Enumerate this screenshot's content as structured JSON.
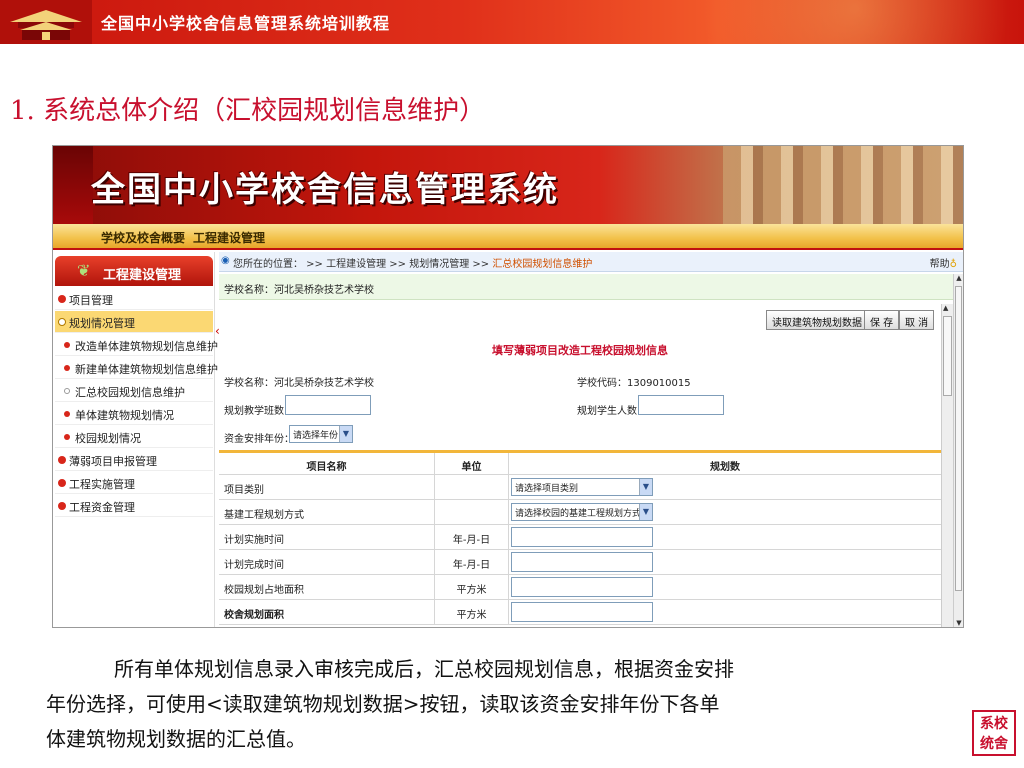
{
  "slide": {
    "header_title": "全国中小学校舍信息管理系统培训教程",
    "section_title": "1. 系统总体介绍（汇校园规划信息维护）",
    "paragraph_line1": "所有单体规划信息录入审核完成后，汇总校园规划信息，根据资金安排",
    "paragraph_line2": "年份选择，可使用<读取建筑物规划数据>按钮，读取该资金安排年份下各单",
    "paragraph_line3": "体建筑物规划数据的汇总值。",
    "seal_text": "系统校舍"
  },
  "app": {
    "system_title": "全国中小学校舍信息管理系统",
    "nav_tabs": [
      "学校及校舍概要",
      "工程建设管理"
    ],
    "sidebar_title": "工程建设管理",
    "sidebar_items": [
      {
        "label": "项目管理",
        "level": "top"
      },
      {
        "label": "规划情况管理",
        "level": "top",
        "state": "active"
      },
      {
        "label": "改造单体建筑物规划信息维护",
        "level": "sub"
      },
      {
        "label": "新建单体建筑物规划信息维护",
        "level": "sub"
      },
      {
        "label": "汇总校园规划信息维护",
        "level": "sub",
        "state": "current"
      },
      {
        "label": "单体建筑物规划情况",
        "level": "sub"
      },
      {
        "label": "校园规划情况",
        "level": "sub"
      },
      {
        "label": "薄弱项目申报管理",
        "level": "top"
      },
      {
        "label": "工程实施管理",
        "level": "top"
      },
      {
        "label": "工程资金管理",
        "level": "top"
      }
    ],
    "breadcrumb": {
      "prefix": "您所在的位置： >> 工程建设管理 >> 规划情况管理 >>",
      "current": "汇总校园规划信息维护",
      "help": "帮助"
    },
    "school_bar": "学校名称：河北吴桥杂技艺术学校",
    "buttons": {
      "read": "读取建筑物规划数据",
      "save": "保 存",
      "cancel": "取 消"
    },
    "form": {
      "title": "填写薄弱项目改造工程校园规划信息",
      "school_name": "学校名称：河北吴桥杂技艺术学校",
      "school_code": "学校代码：1309010015",
      "class_count_label": "规划教学班数：",
      "student_count_label": "规划学生人数：",
      "fund_year_label": "资金安排年份：",
      "fund_year_value": "请选择年份"
    },
    "table": {
      "headers": [
        "项目名称",
        "单位",
        "规划数"
      ],
      "rows": [
        {
          "name": "项目类别",
          "unit": "",
          "field": "select",
          "value": "请选择项目类别"
        },
        {
          "name": "基建工程规划方式",
          "unit": "",
          "field": "select",
          "value": "请选择校园的基建工程规划方式"
        },
        {
          "name": "计划实施时间",
          "unit": "年-月-日",
          "field": "input",
          "value": ""
        },
        {
          "name": "计划完成时间",
          "unit": "年-月-日",
          "field": "input",
          "value": ""
        },
        {
          "name": "校园规划占地面积",
          "unit": "平方米",
          "field": "input",
          "value": ""
        },
        {
          "name": "校舍规划面积",
          "unit": "平方米",
          "field": "input",
          "value": "",
          "bold": true
        }
      ]
    }
  },
  "colors": {
    "brand_red": "#c8102e",
    "nav_gold": "#f2c14a",
    "active_item": "#fbd873"
  }
}
